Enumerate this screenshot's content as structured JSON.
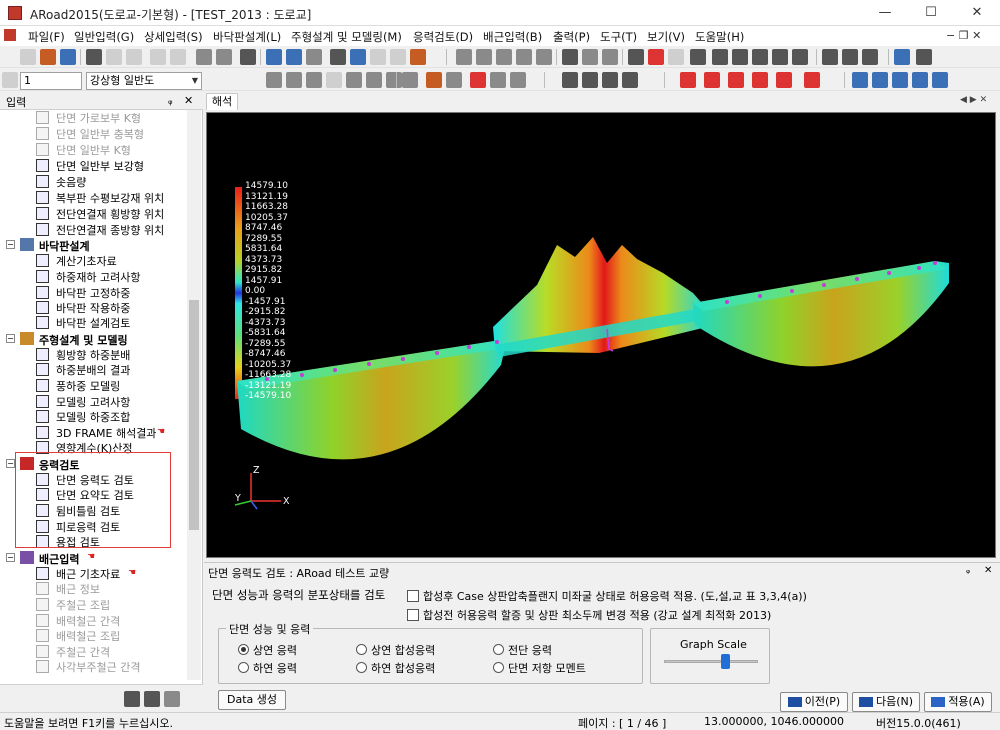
{
  "window": {
    "title": "ARoad2015(도로교-기본형) - [TEST_2013 : 도로교]",
    "minimize": "—",
    "maximize": "☐",
    "close": "✕"
  },
  "menu": [
    "파일(F)",
    "일반입력(G)",
    "상세입력(S)",
    "바닥판설계(L)",
    "주형설계 및 모델링(M)",
    "응력검토(D)",
    "배근입력(B)",
    "출력(P)",
    "도구(T)",
    "보기(V)",
    "도움말(H)"
  ],
  "mdi_controls": "− ❐ ✕",
  "toolbar": {
    "combo_number": "1",
    "combo_type": "강상형 일반도"
  },
  "left_panel": {
    "title": "입력",
    "pin": "ᵩ",
    "close": "✕",
    "items": [
      {
        "label": "단면 가로보부 K형",
        "dim": true
      },
      {
        "label": "단면 일반부 충복형",
        "dim": true
      },
      {
        "label": "단면 일반부 K형",
        "dim": true
      },
      {
        "label": "단면 일반부 보강형",
        "dim": false
      },
      {
        "label": "솟음량",
        "dim": false
      },
      {
        "label": "복부판 수평보강재 위치",
        "dim": false
      },
      {
        "label": "전단연결재 횡방향 위치",
        "dim": false
      },
      {
        "label": "전단연결재 종방향 위치",
        "dim": false
      }
    ],
    "group_slab": "바닥판설계",
    "slab_items": [
      "계산기초자료",
      "하중재하 고려사항",
      "바닥판 고정하중",
      "바닥판 작용하중",
      "바닥판 설계검토"
    ],
    "group_girder": "주형설계 및 모델링",
    "girder_items": [
      "횡방향 하중분배",
      "하중분배의 결과",
      "풍하중 모델링",
      "모델링 고려사항",
      "모델링 하중조합",
      "3D FRAME 해석결과",
      "영향계수(K)산정"
    ],
    "group_stress": "응력검토",
    "stress_items": [
      "단면 응력도 검토",
      "단면 요약도 검토",
      "뒴비틀림 검토",
      "피로응력 검토",
      "용접 검토"
    ],
    "group_rebar": "배근입력",
    "rebar_items": [
      {
        "label": "배근 기초자료",
        "dim": false
      },
      {
        "label": "배근 정보",
        "dim": true
      },
      {
        "label": "주철근 조립",
        "dim": true
      },
      {
        "label": "배력철근 간격",
        "dim": true
      },
      {
        "label": "배력철근 조립",
        "dim": true
      },
      {
        "label": "주철근 간격",
        "dim": true
      },
      {
        "label": "사각부주철근 간격",
        "dim": true
      }
    ]
  },
  "doc_tab": "해석",
  "legend": [
    "14579.10",
    "13121.19",
    "11663.28",
    "10205.37",
    "8747.46",
    "7289.55",
    "5831.64",
    "4373.73",
    "2915.82",
    "1457.91",
    "0.00",
    "-1457.91",
    "-2915.82",
    "-4373.73",
    "-5831.64",
    "-7289.55",
    "-8747.46",
    "-10205.37",
    "-11663.28",
    "-13121.19",
    "-14579.10"
  ],
  "axes": {
    "x": "X",
    "y": "Y",
    "z": "Z"
  },
  "bottom_panel": {
    "title": "단면 응력도 검토 : ARoad 테스트 교량",
    "pin": "ᵩ",
    "close": "✕",
    "description": "단면 성능과 응력의 분포상태를 검토",
    "check1": "합성후 Case 상판압축플랜지 미좌굴 상태로 허용응력 적용. (도,설,교 표 3,3,4(a))",
    "check2": "합성전 허용응력 할증 및 상판 최소두께 변경 적용 (강교 설계 최적화 2013)",
    "group_title": "단면 성능 및 응력",
    "radios": [
      {
        "label": "상연 응력",
        "on": true
      },
      {
        "label": "상연 합성응력",
        "on": false
      },
      {
        "label": "전단 응력",
        "on": false
      },
      {
        "label": "하연 응력",
        "on": false
      },
      {
        "label": "하연 합성응력",
        "on": false
      },
      {
        "label": "단면 저항 모멘트",
        "on": false
      }
    ],
    "graph_scale": "Graph Scale",
    "graph_scale_level": 0.65,
    "data_button": "Data 생성",
    "prev": "이전(P)",
    "next": "다음(N)",
    "apply": "적용(A)"
  },
  "status": {
    "help": "도움말을 보려면 F1키를 누르십시오.",
    "page": "페이지 : [ 1 / 46 ]",
    "coords": "13.000000,    1046.000000",
    "version": "버전15.0.0(461)"
  },
  "colors": {
    "accent": "#1f6fd6",
    "highlight": "#e23b3b",
    "viewport_bg": "#000000"
  }
}
